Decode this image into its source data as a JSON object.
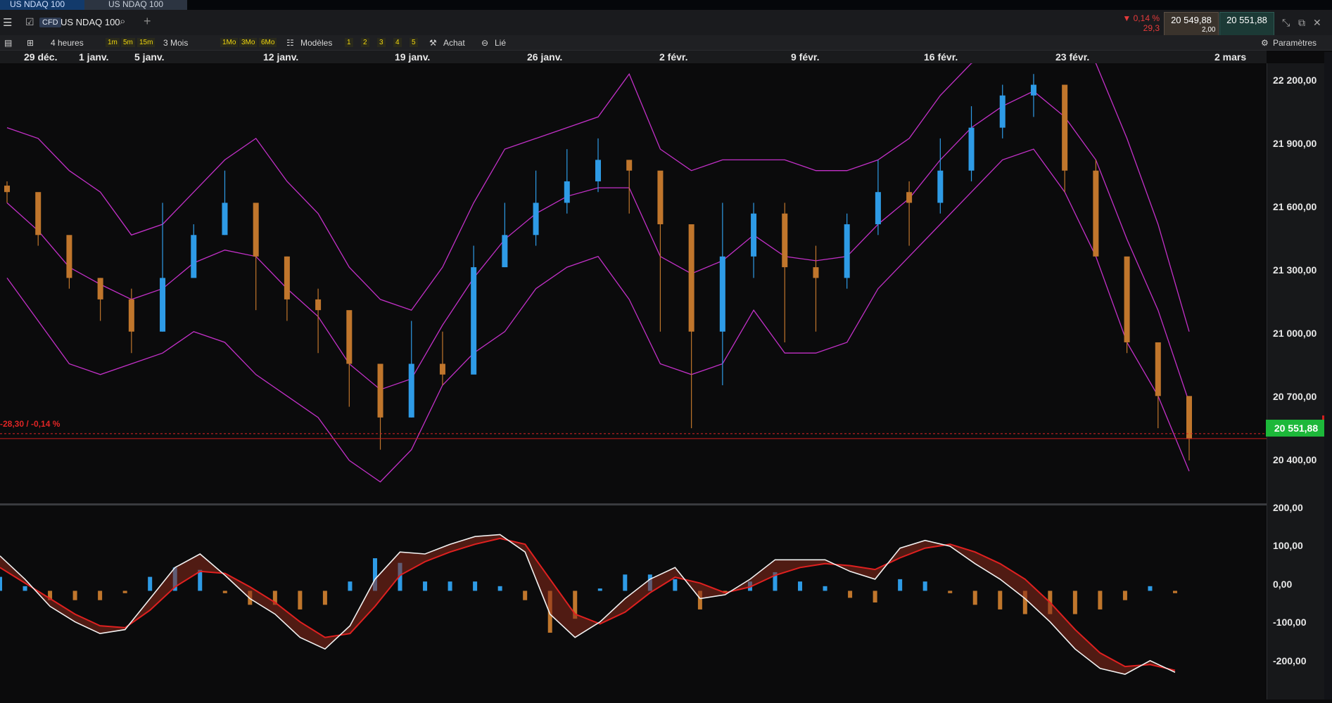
{
  "tabs": [
    {
      "label": "US NDAQ 100"
    },
    {
      "label": "US NDAQ 100"
    }
  ],
  "header": {
    "badge": "CFD",
    "instrument": "US NDAQ 100",
    "change_pct": "▼ 0,14 %",
    "change_abs": "29,3",
    "bid": "20 549,88",
    "ask": "20 551,88",
    "spread": "2,00"
  },
  "toolbar": {
    "period": "4 heures",
    "intervals": [
      "1m",
      "5m",
      "15m"
    ],
    "range": "3 Mois",
    "ranges": [
      "1Mo",
      "3Mo",
      "6Mo"
    ],
    "models_label": "Modèles",
    "models": [
      "1",
      "2",
      "3",
      "4",
      "5"
    ],
    "buy_label": "Achat",
    "linked_label": "Lié",
    "settings_label": "Paramètres"
  },
  "colors": {
    "up": "#2e9be6",
    "down": "#c0762c",
    "bands": "#c330c8",
    "price": "#1db83a",
    "change": "#e02525"
  },
  "chart_data": [
    {
      "type": "candlestick",
      "x_labels": [
        "29 déc.",
        "1 janv.",
        "5 janv.",
        "12 janv.",
        "19 janv.",
        "26 janv.",
        "2 févr.",
        "9 févr.",
        "16 févr.",
        "23 févr.",
        "2 mars"
      ],
      "y_ticks": [
        "22 200,00",
        "21 900,00",
        "21 600,00",
        "21 300,00",
        "21 000,00",
        "20 700,00",
        "20 400,00"
      ],
      "ylim": [
        20250,
        22300
      ],
      "current_price": "20 551,88",
      "change_label": "-28,30 / -0,14 %",
      "close": [
        21700,
        21500,
        21300,
        21200,
        21050,
        21300,
        21500,
        21650,
        21400,
        21200,
        21150,
        20900,
        20650,
        20900,
        20850,
        21350,
        21500,
        21650,
        21750,
        21850,
        21800,
        21550,
        21050,
        21400,
        21600,
        21350,
        21300,
        21550,
        21700,
        21650,
        21800,
        22000,
        22150,
        22200,
        21800,
        21400,
        21000,
        20750,
        20550
      ],
      "high": [
        21750,
        21550,
        21400,
        21300,
        21250,
        21650,
        21550,
        21800,
        21450,
        21400,
        21250,
        20950,
        20800,
        21100,
        21050,
        21450,
        21650,
        21800,
        21900,
        21950,
        21850,
        21600,
        21200,
        21650,
        21650,
        21650,
        21450,
        21600,
        21850,
        21750,
        21950,
        22100,
        22200,
        22250,
        22200,
        21850,
        21350,
        21000,
        20600
      ],
      "low": [
        21650,
        21450,
        21250,
        21100,
        20950,
        21050,
        21450,
        21500,
        21150,
        21100,
        20950,
        20700,
        20500,
        20650,
        20800,
        20900,
        21350,
        21450,
        21600,
        21700,
        21600,
        21050,
        20600,
        20800,
        21300,
        21000,
        21050,
        21250,
        21500,
        21450,
        21600,
        21750,
        21950,
        22050,
        21700,
        21400,
        20950,
        20600,
        20450
      ],
      "bollinger_upper": [
        22000,
        21950,
        21800,
        21700,
        21500,
        21550,
        21700,
        21850,
        21950,
        21750,
        21600,
        21350,
        21200,
        21150,
        21350,
        21650,
        21900,
        21950,
        22000,
        22050,
        22250,
        21900,
        21800,
        21850,
        21850,
        21850,
        21800,
        21800,
        21850,
        21950,
        22150,
        22300,
        22350,
        22450,
        22400,
        22300,
        21950,
        21550,
        21050
      ],
      "bollinger_lower": [
        21300,
        21100,
        20900,
        20850,
        20900,
        20950,
        21050,
        21000,
        20850,
        20750,
        20650,
        20450,
        20350,
        20500,
        20800,
        20950,
        21050,
        21250,
        21350,
        21400,
        21200,
        20900,
        20850,
        20900,
        21150,
        20950,
        20950,
        21000,
        21250,
        21400,
        21550,
        21700,
        21850,
        21900,
        21700,
        21400,
        21000,
        20750,
        20400
      ],
      "bollinger_mid": [
        21650,
        21520,
        21350,
        21270,
        21200,
        21250,
        21370,
        21430,
        21400,
        21250,
        21120,
        20900,
        20780,
        20830,
        21080,
        21300,
        21480,
        21600,
        21680,
        21720,
        21720,
        21400,
        21320,
        21380,
        21500,
        21400,
        21380,
        21400,
        21550,
        21670,
        21850,
        22000,
        22100,
        22170,
        22050,
        21850,
        21480,
        21150,
        20720
      ]
    },
    {
      "type": "macd",
      "y_ticks": [
        "200,00",
        "100,00",
        "0,00",
        "-100,00",
        "-200,00"
      ],
      "ylim": [
        -280,
        220
      ],
      "macd": [
        90,
        30,
        -40,
        -80,
        -110,
        -100,
        -20,
        60,
        95,
        40,
        -20,
        -60,
        -120,
        -150,
        -90,
        30,
        100,
        95,
        120,
        140,
        145,
        100,
        -60,
        -120,
        -80,
        -20,
        30,
        60,
        -20,
        -10,
        30,
        80,
        80,
        80,
        50,
        30,
        110,
        130,
        115,
        70,
        30,
        -20,
        -80,
        -150,
        -200,
        -215,
        -180,
        -210
      ],
      "signal": [
        60,
        20,
        -20,
        -60,
        -90,
        -95,
        -50,
        10,
        50,
        45,
        10,
        -30,
        -80,
        -120,
        -110,
        -40,
        40,
        75,
        100,
        120,
        135,
        120,
        30,
        -60,
        -85,
        -55,
        -5,
        35,
        20,
        -5,
        10,
        40,
        60,
        70,
        65,
        55,
        85,
        110,
        120,
        100,
        70,
        30,
        -30,
        -100,
        -160,
        -195,
        -190,
        -205
      ]
    }
  ]
}
